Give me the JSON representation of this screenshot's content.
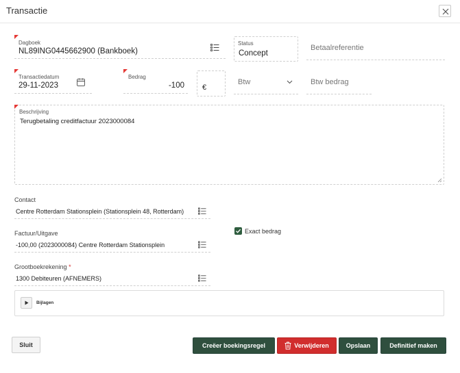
{
  "dialog": {
    "title": "Transactie"
  },
  "dagboek": {
    "label": "Dagboek",
    "value": "NL89ING0445662900 (Bankboek)"
  },
  "status": {
    "label": "Status",
    "value": "Concept"
  },
  "betaalreferentie": {
    "placeholder": "Betaalreferentie"
  },
  "transactiedatum": {
    "label": "Transactiedatum",
    "value": "29-11-2023"
  },
  "bedrag": {
    "label": "Bedrag",
    "value": "-100",
    "currency": "€"
  },
  "btw": {
    "placeholder": "Btw"
  },
  "btw_bedrag": {
    "placeholder": "Btw bedrag"
  },
  "beschrijving": {
    "label": "Beschrijving",
    "value": "Terugbetaling creditfactuur 2023000084"
  },
  "contact": {
    "label": "Contact",
    "value": "Centre Rotterdam Stationsplein (Stationsplein 48, Rotterdam)"
  },
  "factuur": {
    "label": "Factuur/Uitgave",
    "value": "-100,00 (2023000084) Centre Rotterdam Stationsplein"
  },
  "exact_bedrag": {
    "label": "Exact bedrag",
    "checked": true
  },
  "grootboek": {
    "label": "Grootboekrekening",
    "required_mark": "*",
    "value": "1300 Debiteuren (AFNEMERS)"
  },
  "bijlagen": {
    "label": "Bijlagen"
  },
  "footer": {
    "sluit": "Sluit",
    "creeer": "Creëer boekingsregel",
    "verwijderen": "Verwijderen",
    "opslaan": "Opslaan",
    "definitief": "Definitief maken"
  },
  "colors": {
    "primary": "#2f4f3e",
    "danger": "#d12d2d",
    "required": "#e53935"
  }
}
